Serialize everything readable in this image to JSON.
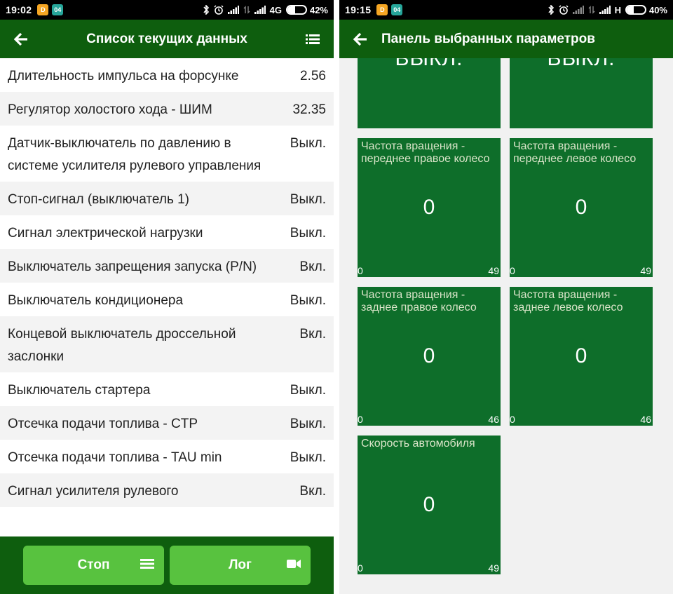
{
  "left": {
    "status": {
      "time": "19:02",
      "notif1": "D",
      "notif2": "04",
      "network": "4G",
      "battery": "42%",
      "battery_level": 42
    },
    "appbar": {
      "title": "Список текущих данных"
    },
    "rows": [
      {
        "label": "Длительность импульса на форсунке",
        "value": "2.56"
      },
      {
        "label": "Регулятор холостого хода - ШИМ",
        "value": "32.35"
      },
      {
        "label": "Датчик-выключатель по давлению в системе усилителя рулевого управления",
        "value": "Выкл."
      },
      {
        "label": "Стоп-сигнал (выключатель 1)",
        "value": "Выкл."
      },
      {
        "label": "Сигнал электрической нагрузки",
        "value": "Выкл."
      },
      {
        "label": "Выключатель запрещения запуска (P/N)",
        "value": "Вкл."
      },
      {
        "label": "Выключатель кондиционера",
        "value": "Выкл."
      },
      {
        "label": "Концевой выключатель дроссельной заслонки",
        "value": "Вкл."
      },
      {
        "label": "Выключатель стартера",
        "value": "Выкл."
      },
      {
        "label": "Отсечка подачи топлива - CTP",
        "value": "Выкл."
      },
      {
        "label": "Отсечка подачи топлива - TAU min",
        "value": "Выкл."
      },
      {
        "label": "Сигнал усилителя рулевого",
        "value": "Вкл."
      }
    ],
    "buttons": {
      "stop": "Стоп",
      "log": "Лог"
    }
  },
  "right": {
    "status": {
      "time": "19:15",
      "notif1": "D",
      "notif2": "04",
      "network": "H",
      "battery": "40%",
      "battery_level": 40
    },
    "appbar": {
      "title": "Панель выбранных параметров"
    },
    "top_tiles": [
      {
        "value": "ВЫКЛ."
      },
      {
        "value": "ВЫКЛ."
      }
    ],
    "tiles": [
      {
        "label": "Частота вращения - переднее правое колесо",
        "value": "0",
        "min": "0",
        "max": "49"
      },
      {
        "label": "Частота вращения - переднее левое колесо",
        "value": "0",
        "min": "0",
        "max": "49"
      },
      {
        "label": "Частота вращения - заднее правое колесо",
        "value": "0",
        "min": "0",
        "max": "46"
      },
      {
        "label": "Частота вращения - заднее левое колесо",
        "value": "0",
        "min": "0",
        "max": "46"
      },
      {
        "label": "Скорость автомобиля",
        "value": "0",
        "min": "0",
        "max": "49"
      }
    ]
  }
}
